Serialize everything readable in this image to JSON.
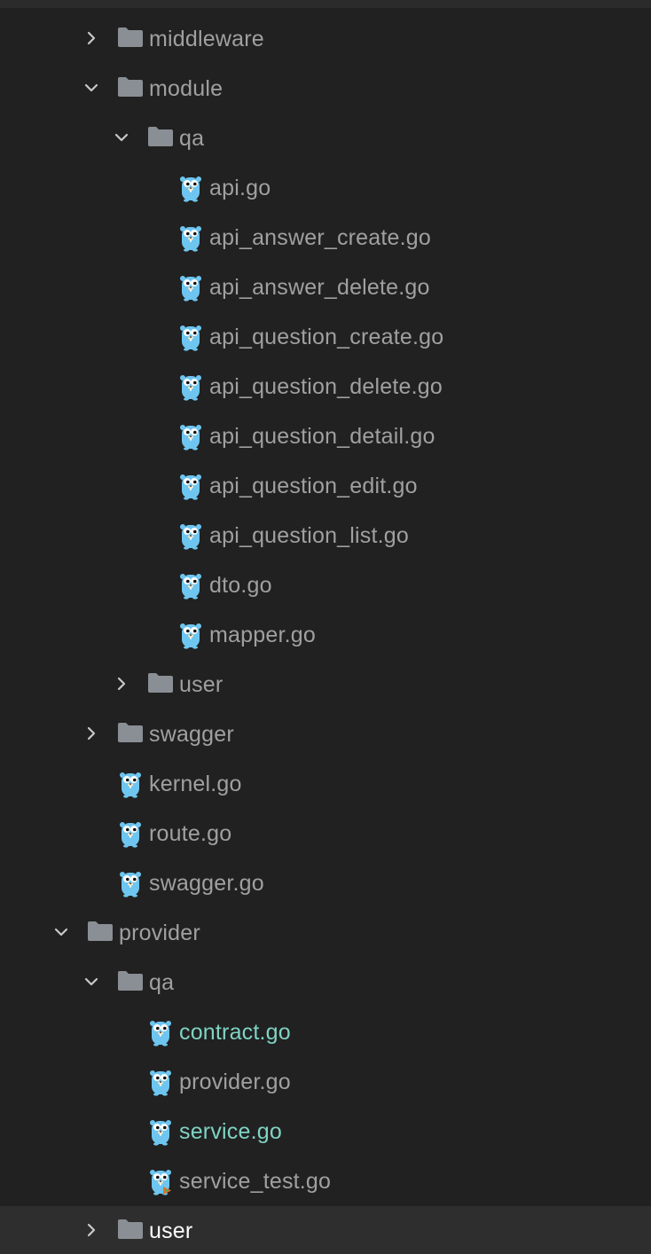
{
  "tree": {
    "rows": [
      {
        "kind": "folder",
        "level": 2,
        "state": "collapsed",
        "label": "middleware",
        "icon": "folder-icon"
      },
      {
        "kind": "folder",
        "level": 2,
        "state": "expanded",
        "label": "module",
        "icon": "folder-icon"
      },
      {
        "kind": "folder",
        "level": 3,
        "state": "expanded",
        "label": "qa",
        "icon": "folder-icon"
      },
      {
        "kind": "file",
        "level": 4,
        "label": "api.go",
        "icon": "go-gopher-icon"
      },
      {
        "kind": "file",
        "level": 4,
        "label": "api_answer_create.go",
        "icon": "go-gopher-icon"
      },
      {
        "kind": "file",
        "level": 4,
        "label": "api_answer_delete.go",
        "icon": "go-gopher-icon"
      },
      {
        "kind": "file",
        "level": 4,
        "label": "api_question_create.go",
        "icon": "go-gopher-icon"
      },
      {
        "kind": "file",
        "level": 4,
        "label": "api_question_delete.go",
        "icon": "go-gopher-icon"
      },
      {
        "kind": "file",
        "level": 4,
        "label": "api_question_detail.go",
        "icon": "go-gopher-icon"
      },
      {
        "kind": "file",
        "level": 4,
        "label": "api_question_edit.go",
        "icon": "go-gopher-icon"
      },
      {
        "kind": "file",
        "level": 4,
        "label": "api_question_list.go",
        "icon": "go-gopher-icon"
      },
      {
        "kind": "file",
        "level": 4,
        "label": "dto.go",
        "icon": "go-gopher-icon"
      },
      {
        "kind": "file",
        "level": 4,
        "label": "mapper.go",
        "icon": "go-gopher-icon"
      },
      {
        "kind": "folder",
        "level": 3,
        "state": "collapsed",
        "label": "user",
        "icon": "folder-icon"
      },
      {
        "kind": "folder",
        "level": 2,
        "state": "collapsed",
        "label": "swagger",
        "icon": "folder-icon"
      },
      {
        "kind": "file",
        "level": 2,
        "label": "kernel.go",
        "icon": "go-gopher-icon"
      },
      {
        "kind": "file",
        "level": 2,
        "label": "route.go",
        "icon": "go-gopher-icon"
      },
      {
        "kind": "file",
        "level": 2,
        "label": "swagger.go",
        "icon": "go-gopher-icon"
      },
      {
        "kind": "folder",
        "level": 1,
        "state": "expanded",
        "label": "provider",
        "icon": "folder-icon"
      },
      {
        "kind": "folder",
        "level": 2,
        "state": "expanded",
        "label": "qa",
        "icon": "folder-icon"
      },
      {
        "kind": "file",
        "level": 3,
        "label": "contract.go",
        "icon": "go-gopher-icon",
        "status": "modified"
      },
      {
        "kind": "file",
        "level": 3,
        "label": "provider.go",
        "icon": "go-gopher-icon"
      },
      {
        "kind": "file",
        "level": 3,
        "label": "service.go",
        "icon": "go-gopher-icon",
        "status": "modified"
      },
      {
        "kind": "file",
        "level": 3,
        "label": "service_test.go",
        "icon": "go-test-gopher-icon"
      },
      {
        "kind": "folder",
        "level": 2,
        "state": "collapsed",
        "label": "user",
        "icon": "folder-icon",
        "selected": true
      }
    ]
  },
  "colors": {
    "background": "#212121",
    "selected_row": "#2e2e2e",
    "text": "#a0a0a0",
    "modified_text": "#7fd3c3",
    "selected_text": "#ffffff",
    "folder": "#8a8f95",
    "gopher": "#6ec6f0"
  }
}
